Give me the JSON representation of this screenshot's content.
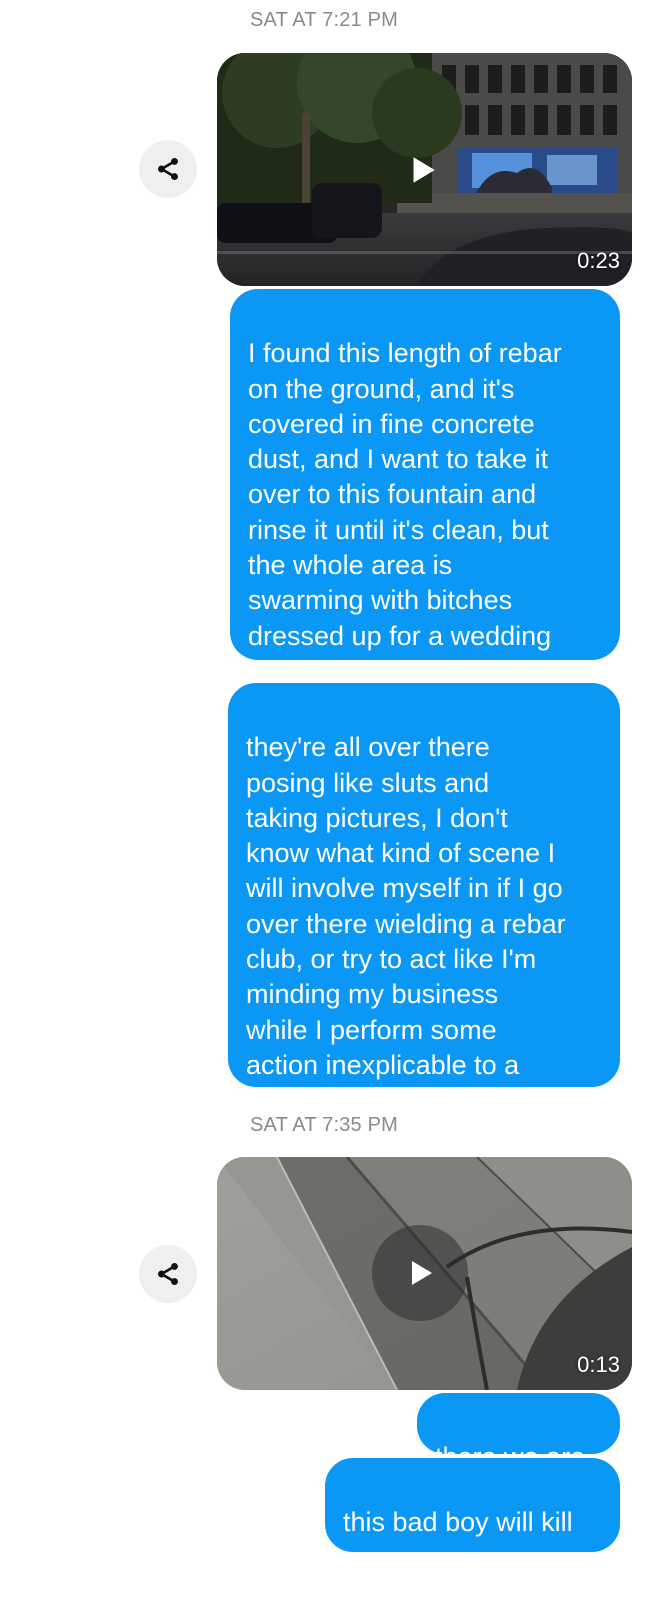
{
  "colors": {
    "bubble": "#0a97f5",
    "timestamp": "#8a8a8a",
    "share_bg": "#efefef"
  },
  "messages": [
    {
      "timestamp": "SAT AT 7:21 PM"
    },
    {
      "video_duration": "0:23",
      "icon": "play-icon",
      "share_icon": "share-icon"
    },
    {
      "text": "I found this length of rebar\non the ground, and it's\ncovered in fine concrete\ndust, and I want to take it\nover to this fountain and\nrinse it until it's clean, but\nthe whole area is\nswarming with bitches\ndressed up for a wedding\nor something"
    },
    {
      "text": "they're all over there\nposing like sluts and\ntaking pictures, I don't\nknow what kind of scene I\nwill involve myself in if I go\nover there wielding a rebar\nclub, or try to act like I'm\nminding my business\nwhile I perform some\naction inexplicable to a\nnormal person"
    },
    {
      "timestamp": "SAT AT 7:35 PM"
    },
    {
      "video_duration": "0:13",
      "icon": "play-icon",
      "share_icon": "share-icon"
    },
    {
      "text": "there we are"
    },
    {
      "text": "this bad boy will kill\nsomeone"
    }
  ]
}
